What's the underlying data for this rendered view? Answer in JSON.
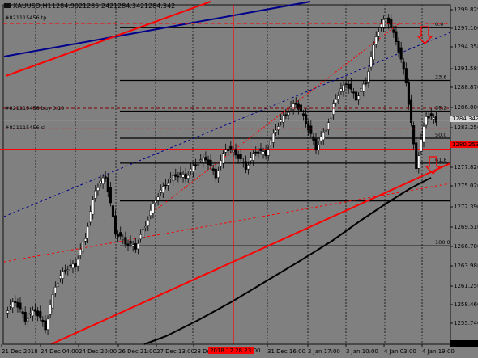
{
  "header": {
    "symbol": "XAUUSD,H1",
    "open": "1284.902",
    "high": "1285.242",
    "low": "1284.342",
    "close": "1284.342"
  },
  "colors": {
    "background": "#808080",
    "grid": "#303030",
    "bull": "#ffffff",
    "bear": "#000000",
    "fib": "#000000",
    "channel_red": "#ff0000",
    "channel_blue": "#00008b",
    "ma": "#000000",
    "price_tag_bid": "#d8d8d8",
    "price_tag_red": "#ff0000"
  },
  "annotations": {
    "tp_label": "#821115456 tp",
    "buy_label": "#821115456 buy 0.10",
    "sl_label": "#821115456 sl",
    "fib_labels": [
      "0.0",
      "23.6",
      "38.2",
      "50.0",
      "61.8",
      "100.0"
    ]
  },
  "price_axis": {
    "labels": [
      "1299.829",
      "1297.100",
      "1294.358",
      "1291.588",
      "1288.870",
      "1286.006",
      "1283.256",
      "1280.253",
      "1277.820",
      "1275.026",
      "1272.390",
      "1269.510",
      "1266.780",
      "1263.988",
      "1261.256",
      "1258.460",
      "1255.740",
      "1252.949"
    ],
    "current_price": "1284.342",
    "line_price": "1280.253",
    "bottom_tag": "1252.949"
  },
  "time_axis": {
    "labels": [
      "21 Dec 2018",
      "24 Dec 04:00",
      "24 Dec 20:00",
      "26 Dec 21:00",
      "27 Dec 13:00",
      "28 Dec 05:00",
      "31 Dec 16:00",
      "2 Jan 17:00",
      "3 Jan 10:00",
      "4 Jan 03:00",
      "4 Jan 19:00"
    ],
    "highlight_label": "2018.12.28 23:00"
  },
  "chart_data": {
    "type": "candlestick",
    "symbol": "XAUUSD",
    "timeframe": "H1",
    "ylim": [
      1252.9,
      1300.5
    ],
    "x_labels": [
      "21 Dec 2018",
      "24 Dec 04:00",
      "24 Dec 20:00",
      "26 Dec 21:00",
      "27 Dec 13:00",
      "28 Dec 05:00",
      "31 Dec 16:00",
      "2 Jan 17:00",
      "3 Jan 10:00",
      "4 Jan 03:00",
      "4 Jan 19:00"
    ],
    "close_path": [
      1257.5,
      1259.0,
      1256.4,
      1257.8,
      1255.2,
      1261.2,
      1263.5,
      1264.1,
      1268.0,
      1274.7,
      1276.5,
      1268.6,
      1267.2,
      1266.5,
      1269.7,
      1273.3,
      1275.4,
      1276.7,
      1276.4,
      1278.2,
      1279.0,
      1276.5,
      1280.5,
      1279.7,
      1277.7,
      1280.1,
      1279.6,
      1283.2,
      1285.3,
      1286.8,
      1284.1,
      1280.4,
      1283.2,
      1287.5,
      1289.6,
      1287.4,
      1289.8,
      1296.3,
      1298.9,
      1295.6,
      1289.8,
      1277.8,
      1285.1,
      1284.3
    ],
    "fibonacci": [
      {
        "level": "0.0",
        "price": 1297.3
      },
      {
        "level": "23.6",
        "price": 1289.9
      },
      {
        "level": "38.2",
        "price": 1285.6
      },
      {
        "level": "50.0",
        "price": 1281.8
      },
      {
        "level": "61.8",
        "price": 1278.3
      },
      {
        "level": "100.0",
        "price": 1266.7
      }
    ],
    "extra_levels": [
      1273.0,
      1280.25
    ],
    "orders": {
      "tp": 1297.9,
      "buy": 1286.0,
      "sl": 1283.2
    },
    "current_price": 1284.342
  }
}
